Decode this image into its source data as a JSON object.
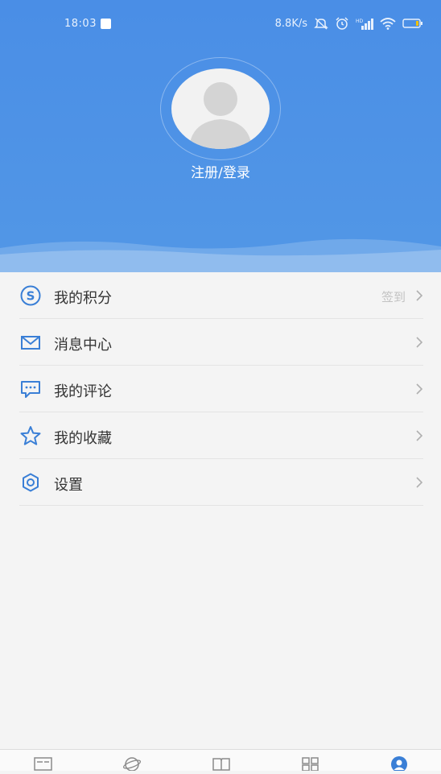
{
  "status_bar": {
    "time": "18:03",
    "speed": "8.8K/s"
  },
  "profile": {
    "login_label": "注册/登录"
  },
  "menu": {
    "items": [
      {
        "label": "我的积分",
        "right_text": "签到",
        "icon": "points-s-icon"
      },
      {
        "label": "消息中心",
        "right_text": "",
        "icon": "envelope-icon"
      },
      {
        "label": "我的评论",
        "right_text": "",
        "icon": "comment-bubble-icon"
      },
      {
        "label": "我的收藏",
        "right_text": "",
        "icon": "star-icon"
      },
      {
        "label": "设置",
        "right_text": "",
        "icon": "gear-icon"
      }
    ]
  },
  "tabbar": {
    "tabs": [
      {
        "icon": "news-icon"
      },
      {
        "icon": "planet-icon"
      },
      {
        "icon": "book-icon"
      },
      {
        "icon": "grid-icon"
      },
      {
        "icon": "user-icon",
        "active": true
      }
    ]
  },
  "colors": {
    "header": "#4a8ee6",
    "accent": "#3a7fd6",
    "menu_text": "#333333"
  }
}
